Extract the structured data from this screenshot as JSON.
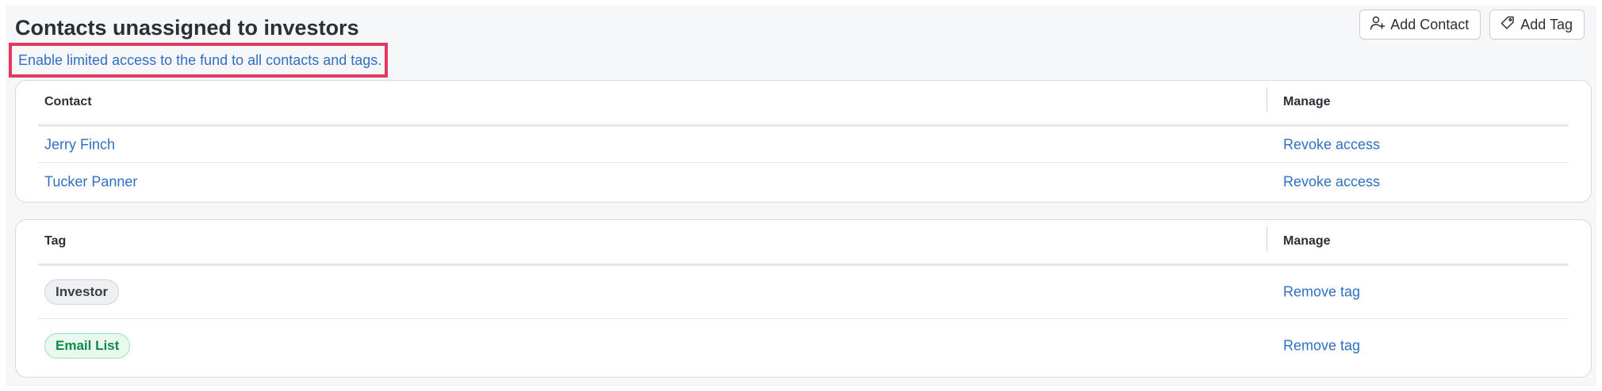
{
  "page": {
    "title": "Contacts unassigned to investors",
    "enable_link": "Enable limited access to the fund to all contacts and tags."
  },
  "toolbar": {
    "add_contact": {
      "label": "Add Contact",
      "icon": "user-plus-icon"
    },
    "add_tag": {
      "label": "Add Tag",
      "icon": "tag-icon"
    }
  },
  "contacts_table": {
    "headers": [
      "Contact",
      "Manage"
    ],
    "rows": [
      {
        "name": "Jerry Finch",
        "action": "Revoke access"
      },
      {
        "name": "Tucker Panner",
        "action": "Revoke access"
      }
    ]
  },
  "tags_table": {
    "headers": [
      "Tag",
      "Manage"
    ],
    "rows": [
      {
        "tag": "Investor",
        "tag_color": "gray",
        "action": "Remove tag"
      },
      {
        "tag": "Email List",
        "tag_color": "green",
        "action": "Remove tag"
      }
    ]
  },
  "colors": {
    "link": "#2f6fc4",
    "highlight_border": "#e23a5e",
    "tag_gray_bg": "#eef0f3",
    "tag_green_bg": "#e9f9f0",
    "tag_green_text": "#0f8a4a"
  }
}
